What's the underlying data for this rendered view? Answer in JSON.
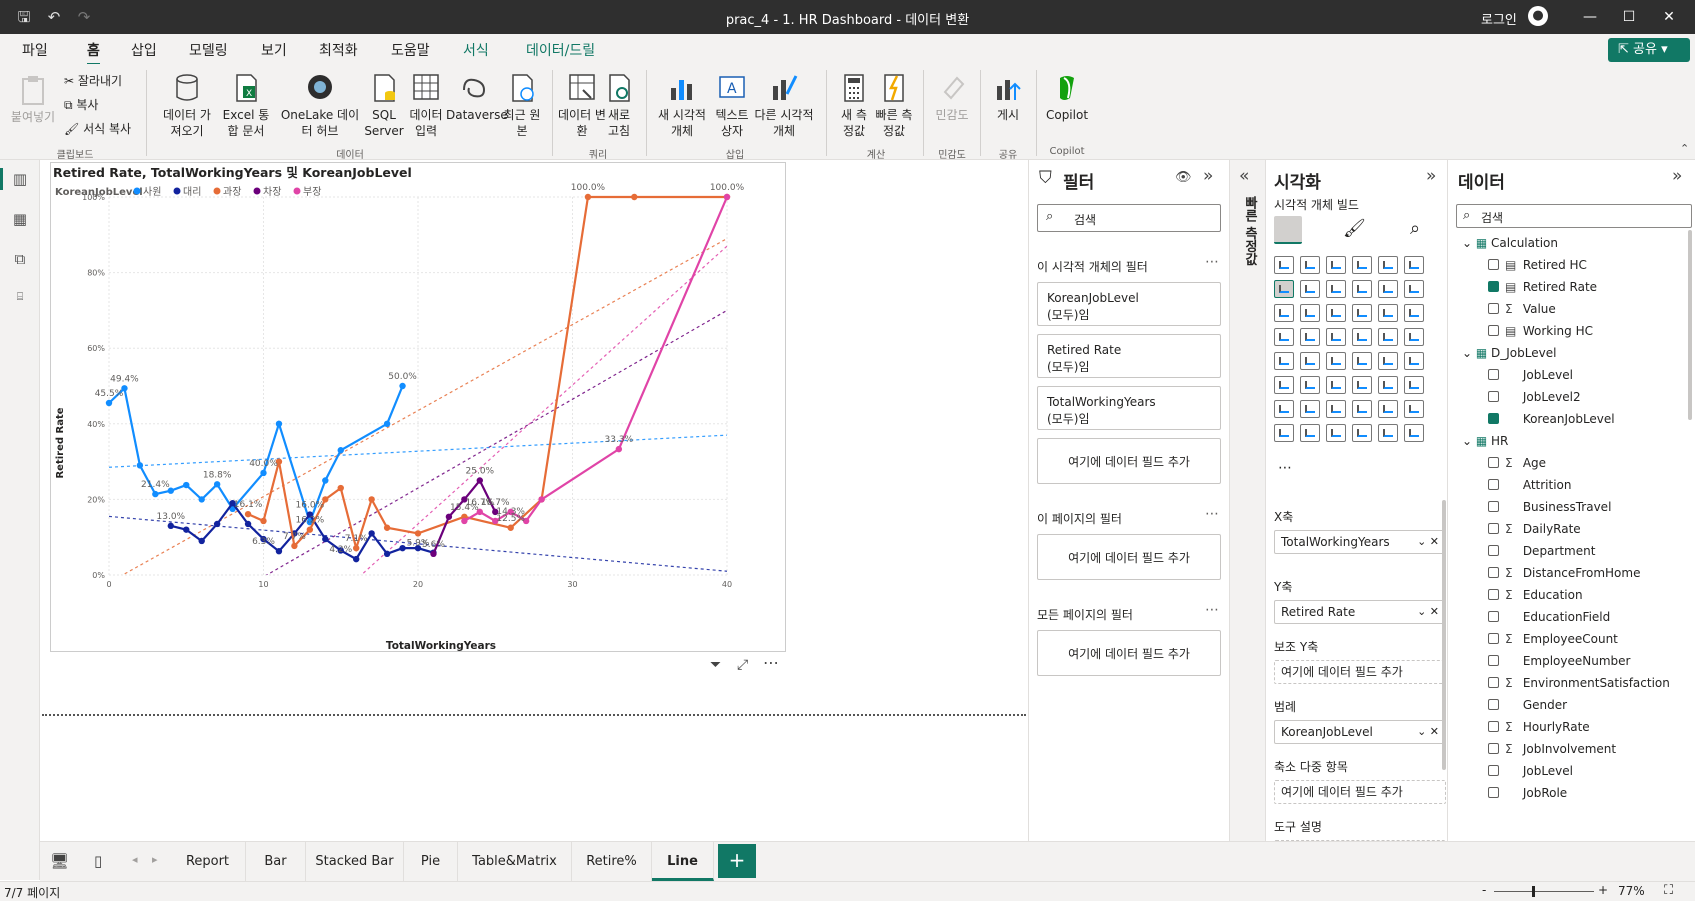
{
  "titlebar": {
    "title": "prac_4 - 1. HR Dashboard - 데이터 변환",
    "login": "로그인"
  },
  "menu": {
    "tabs": [
      "파일",
      "홈",
      "삽입",
      "모델링",
      "보기",
      "최적화",
      "도움말",
      "서식",
      "데이터/드릴"
    ],
    "active": "홈",
    "share": "공유"
  },
  "ribbon": {
    "paste": "붙여넣기",
    "cut": "잘라내기",
    "copy": "복사",
    "format_copy": "서식 복사",
    "get_data": "데이터 가져오기",
    "excel": "Excel 통합 문서",
    "onelake": "OneLake 데이터 허브",
    "sql": "SQL Server",
    "enter_data": "데이터 입력",
    "dataverse": "Dataverse",
    "recent": "최근 원본",
    "transform": "데이터 변환",
    "refresh": "새로 고침",
    "new_visual": "새 시각적 개체",
    "textbox": "텍스트 상자",
    "more_visuals": "다른 시각적 개체",
    "new_measure": "새 측정값",
    "quick_measure": "빠른 측정값",
    "sensitivity": "민감도",
    "publish": "게시",
    "copilot": "Copilot",
    "groups": [
      "클립보드",
      "데이터",
      "쿼리",
      "삽입",
      "계산",
      "민감도",
      "공유",
      "Copilot"
    ]
  },
  "chart_data": {
    "type": "line",
    "title": "Retired Rate, TotalWorkingYears 및 KoreanJobLevel",
    "legend_title": "KoreanJobLevel",
    "xlabel": "TotalWorkingYears",
    "ylabel": "Retired Rate",
    "xlim": [
      0,
      40
    ],
    "ylim": [
      0,
      100
    ],
    "xticks": [
      "0",
      "10",
      "20",
      "30",
      "40"
    ],
    "yticks": [
      "0%",
      "20%",
      "40%",
      "60%",
      "80%",
      "100%"
    ],
    "series": [
      {
        "name": "사원",
        "color": "#118dff",
        "x": [
          0,
          1,
          2,
          3,
          4,
          5,
          6,
          7,
          8,
          10,
          11,
          13,
          14,
          15,
          18,
          19
        ],
        "y": [
          45.5,
          49.4,
          29.0,
          21.4,
          22.3,
          23.8,
          20.0,
          24.0,
          17.5,
          27.0,
          40.0,
          14.0,
          25.0,
          33.0,
          40.0,
          50.0
        ],
        "trend": [
          28.5,
          37.0
        ]
      },
      {
        "name": "대리",
        "color": "#12239e",
        "x": [
          4,
          5,
          6,
          7,
          8,
          9,
          10,
          11,
          12,
          13,
          14,
          15,
          16,
          17,
          18,
          19,
          20,
          21
        ],
        "y": [
          13.0,
          12.0,
          9.0,
          13.5,
          19.0,
          13.5,
          9.5,
          6.3,
          11.0,
          16.0,
          9.5,
          6.5,
          4.2,
          11.0,
          5.6,
          7.1,
          7.1,
          5.9
        ],
        "trend": [
          15.5,
          1.0
        ]
      },
      {
        "name": "과장",
        "color": "#e66c37",
        "x": [
          9,
          10,
          11,
          12,
          13,
          14,
          15,
          16,
          17,
          18,
          20,
          23,
          26,
          28,
          31,
          34,
          40
        ],
        "y": [
          16.1,
          14.3,
          30.0,
          7.7,
          12.0,
          20.0,
          23.0,
          7.1,
          20.0,
          12.5,
          11.0,
          15.4,
          12.5,
          20.0,
          100.0,
          100.0,
          100.0
        ],
        "trend": [
          -2.0,
          89.0
        ]
      },
      {
        "name": "차장",
        "color": "#6b007b",
        "x": [
          21,
          22,
          23,
          24,
          25
        ],
        "y": [
          5.6,
          15.4,
          20.0,
          25.0,
          16.7
        ],
        "trend": [
          -24.0,
          70.0
        ]
      },
      {
        "name": "부장",
        "color": "#e044a7",
        "x": [
          23,
          24,
          25,
          26,
          27,
          28,
          33,
          40
        ],
        "y": [
          14.3,
          16.7,
          14.3,
          16.7,
          14.3,
          20.0,
          33.3,
          100.0
        ],
        "trend": [
          -60.0,
          87.0
        ]
      }
    ],
    "data_labels": [
      {
        "x": 1,
        "y": 49.4,
        "t": "49.4%"
      },
      {
        "x": 0,
        "y": 45.5,
        "t": "45.5%"
      },
      {
        "x": 3,
        "y": 21.4,
        "t": "21.4%"
      },
      {
        "x": 4,
        "y": 13.0,
        "t": "13.0%"
      },
      {
        "x": 7,
        "y": 24.0,
        "t": "18.8%"
      },
      {
        "x": 9,
        "y": 16.1,
        "t": "16.1%"
      },
      {
        "x": 10,
        "y": 27.0,
        "t": "40.0%"
      },
      {
        "x": 10,
        "y": 6.3,
        "t": "6.3%"
      },
      {
        "x": 12,
        "y": 7.7,
        "t": "7.7%"
      },
      {
        "x": 13,
        "y": 16.0,
        "t": "16.0%"
      },
      {
        "x": 13,
        "y": 12.0,
        "t": "16.2%"
      },
      {
        "x": 15,
        "y": 4.2,
        "t": "4.2%"
      },
      {
        "x": 16,
        "y": 7.1,
        "t": "7.1%"
      },
      {
        "x": 19,
        "y": 50.0,
        "t": "50.0%"
      },
      {
        "x": 20,
        "y": 5.9,
        "t": "5.9%"
      },
      {
        "x": 21,
        "y": 5.6,
        "t": "5.6%"
      },
      {
        "x": 23,
        "y": 15.4,
        "t": "15.4%"
      },
      {
        "x": 24,
        "y": 25.0,
        "t": "25.0%"
      },
      {
        "x": 24,
        "y": 16.7,
        "t": "16.7%"
      },
      {
        "x": 26,
        "y": 12.5,
        "t": "12.5%"
      },
      {
        "x": 26,
        "y": 14.3,
        "t": "14.3%"
      },
      {
        "x": 25,
        "y": 16.7,
        "t": "16.7%"
      },
      {
        "x": 31,
        "y": 100.0,
        "t": "100.0%"
      },
      {
        "x": 33,
        "y": 33.3,
        "t": "33.3%"
      },
      {
        "x": 40,
        "y": 100.0,
        "t": "100.0%"
      }
    ]
  },
  "filters": {
    "title": "필터",
    "search": "검색",
    "visual_section": "이 시각적 개체의 필터",
    "cards": [
      {
        "field": "KoreanJobLevel",
        "state": "(모두)임"
      },
      {
        "field": "Retired Rate",
        "state": "(모두)임"
      },
      {
        "field": "TotalWorkingYears",
        "state": "(모두)임"
      }
    ],
    "add": "여기에 데이터 필드 추가",
    "page_section": "이 페이지의 필터",
    "all_section": "모든 페이지의 필터"
  },
  "quick_measure_tab": "빠른 측정값",
  "viz": {
    "title": "시각화",
    "build": "시각적 개체 빌드",
    "xaxis": "X축",
    "xaxis_field": "TotalWorkingYears",
    "yaxis": "Y축",
    "yaxis_field": "Retired Rate",
    "y2axis": "보조 Y축",
    "legend": "범례",
    "legend_field": "KoreanJobLevel",
    "small_multiples": "축소 다중 항목",
    "tooltip": "도구 설명",
    "add": "여기에 데이터 필드 추가"
  },
  "data": {
    "title": "데이터",
    "search": "검색",
    "tables": [
      {
        "name": "Calculation",
        "fields": [
          {
            "n": "Retired HC",
            "s": "calc",
            "c": false
          },
          {
            "n": "Retired Rate",
            "s": "calc",
            "c": true
          },
          {
            "n": "Value",
            "s": "sum",
            "c": false
          },
          {
            "n": "Working HC",
            "s": "calc",
            "c": false
          }
        ]
      },
      {
        "name": "D_JobLevel",
        "fields": [
          {
            "n": "JobLevel",
            "s": "",
            "c": false
          },
          {
            "n": "JobLevel2",
            "s": "",
            "c": false
          },
          {
            "n": "KoreanJobLevel",
            "s": "",
            "c": true
          }
        ]
      },
      {
        "name": "HR",
        "fields": [
          {
            "n": "Age",
            "s": "sum",
            "c": false
          },
          {
            "n": "Attrition",
            "s": "",
            "c": false
          },
          {
            "n": "BusinessTravel",
            "s": "",
            "c": false
          },
          {
            "n": "DailyRate",
            "s": "sum",
            "c": false
          },
          {
            "n": "Department",
            "s": "",
            "c": false
          },
          {
            "n": "DistanceFromHome",
            "s": "sum",
            "c": false
          },
          {
            "n": "Education",
            "s": "sum",
            "c": false
          },
          {
            "n": "EducationField",
            "s": "",
            "c": false
          },
          {
            "n": "EmployeeCount",
            "s": "sum",
            "c": false
          },
          {
            "n": "EmployeeNumber",
            "s": "",
            "c": false
          },
          {
            "n": "EnvironmentSatisfaction",
            "s": "sum",
            "c": false
          },
          {
            "n": "Gender",
            "s": "",
            "c": false
          },
          {
            "n": "HourlyRate",
            "s": "sum",
            "c": false
          },
          {
            "n": "JobInvolvement",
            "s": "sum",
            "c": false
          },
          {
            "n": "JobLevel",
            "s": "",
            "c": false
          },
          {
            "n": "JobRole",
            "s": "",
            "c": false
          }
        ]
      }
    ]
  },
  "pages": {
    "tabs": [
      "Report",
      "Bar",
      "Stacked Bar",
      "Pie",
      "Table&Matrix",
      "Retire%",
      "Line"
    ],
    "active": "Line"
  },
  "status": {
    "page": "7/7 페이지",
    "zoom": "77%"
  },
  "colors": {
    "accent": "#117865"
  }
}
